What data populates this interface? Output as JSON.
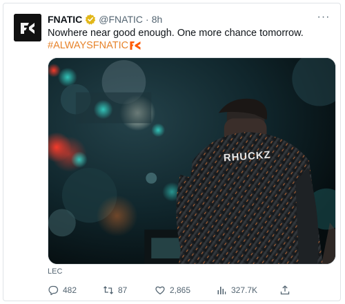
{
  "tweet": {
    "display_name": "FNATIC",
    "handle": "@FNATIC",
    "separator": "·",
    "time": "8h",
    "text": "Nowhere near good enough. One more chance tomorrow.",
    "hashtag": "#ALWAYSFNATIC",
    "more_label": "···",
    "source": "LEC",
    "media_jersey_name": "RHUCKZ"
  },
  "metrics": {
    "replies": "482",
    "retweets": "87",
    "likes": "2,865",
    "views": "327.7K"
  },
  "icons": {
    "avatar": "fnatic-logo-icon",
    "verified": "verified-badge-icon",
    "hashtag_emoji": "fnatic-emoji-icon",
    "reply": "reply-icon",
    "retweet": "retweet-icon",
    "like": "heart-icon",
    "views": "views-icon",
    "share": "share-icon"
  },
  "colors": {
    "brand": "#ff5900",
    "hashtag": "#e7832a",
    "verified": "#e2b719",
    "muted": "#536471"
  }
}
